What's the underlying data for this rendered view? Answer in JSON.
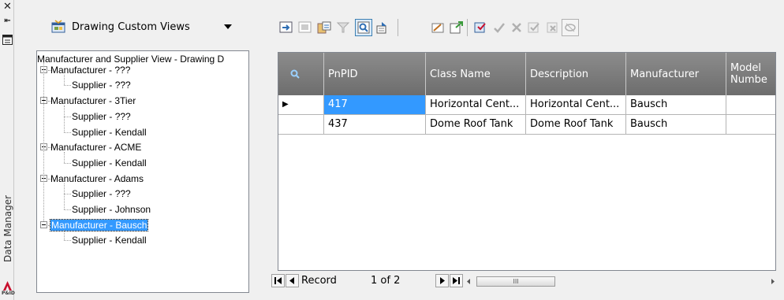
{
  "window": {
    "side_label": "Data Manager",
    "pid_badge": "P&ID"
  },
  "view_selector": {
    "selected": "Drawing Custom Views"
  },
  "tree": {
    "root": "Manufacturer and Supplier View - Drawing D",
    "items": [
      {
        "label": "Manufacturer - ???",
        "level": 1
      },
      {
        "label": "Supplier - ???",
        "level": 2
      },
      {
        "label": "Manufacturer - 3Tier",
        "level": 1
      },
      {
        "label": "Supplier - ???",
        "level": 2
      },
      {
        "label": "Supplier - Kendall",
        "level": 2
      },
      {
        "label": "Manufacturer - ACME",
        "level": 1
      },
      {
        "label": "Supplier - Kendall",
        "level": 2
      },
      {
        "label": "Manufacturer - Adams",
        "level": 1
      },
      {
        "label": "Supplier - ???",
        "level": 2
      },
      {
        "label": "Supplier - Johnson",
        "level": 2
      },
      {
        "label": "Manufacturer - Bausch",
        "level": 1,
        "selected": true
      },
      {
        "label": "Supplier - Kendall",
        "level": 2
      }
    ]
  },
  "grid": {
    "columns": [
      "",
      "PnPID",
      "Class Name",
      "Description",
      "Manufacturer",
      "Model Numbe"
    ],
    "rows": [
      {
        "indicator": "▶",
        "cells": [
          "417",
          "Horizontal Cent...",
          "Horizontal Cent...",
          "Bausch",
          ""
        ]
      },
      {
        "indicator": "",
        "cells": [
          "437",
          "Dome Roof Tank",
          "Dome Roof Tank",
          "Bausch",
          ""
        ]
      }
    ]
  },
  "navigator": {
    "record_label": "Record",
    "position": "1 of 2",
    "scroll_grip": "III"
  },
  "colors": {
    "selection": "#3399ff",
    "header_bg": "#7a7a7a",
    "accent_red": "#c8102e"
  }
}
